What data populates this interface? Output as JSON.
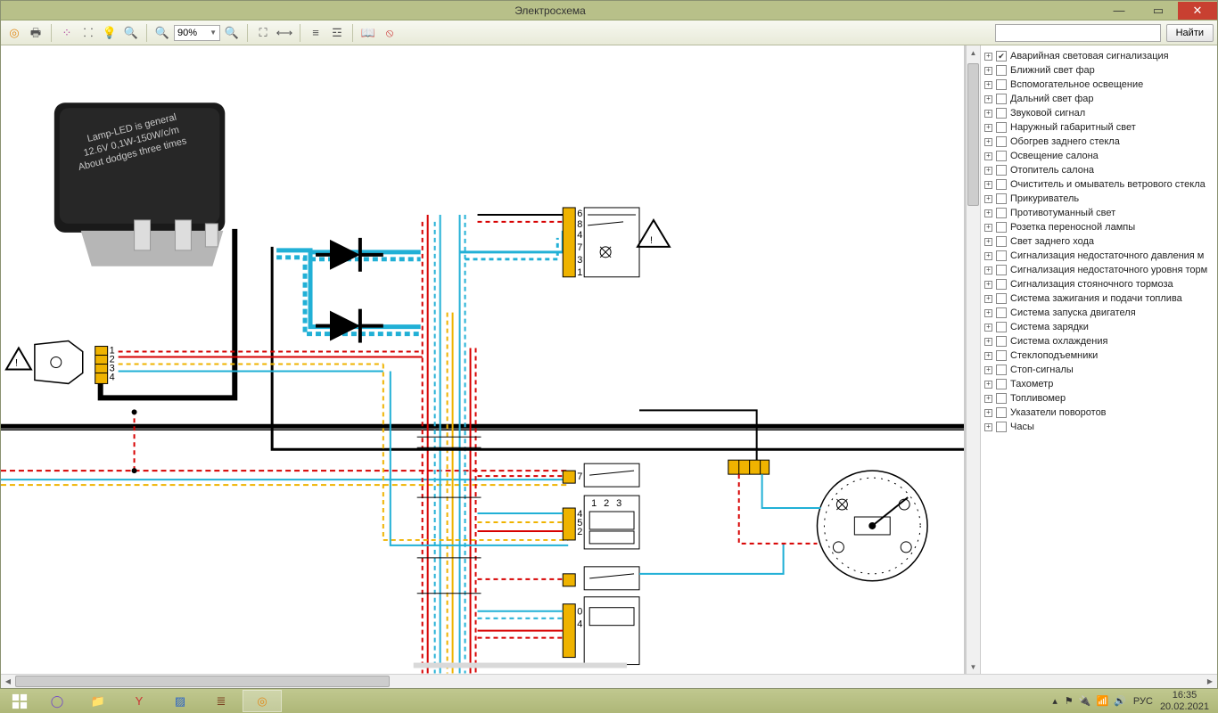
{
  "window": {
    "title": "Электросхема"
  },
  "toolbar": {
    "zoom_value": "90%",
    "find_label": "Найти",
    "search_placeholder": ""
  },
  "sidepanel": {
    "items": [
      {
        "label": "Аварийная световая сигнализация",
        "checked": true
      },
      {
        "label": "Ближний свет фар",
        "checked": false
      },
      {
        "label": "Вспомогательное освещение",
        "checked": false
      },
      {
        "label": "Дальний свет фар",
        "checked": false
      },
      {
        "label": "Звуковой сигнал",
        "checked": false
      },
      {
        "label": "Наружный габаритный свет",
        "checked": false
      },
      {
        "label": "Обогрев заднего стекла",
        "checked": false
      },
      {
        "label": "Освещение салона",
        "checked": false
      },
      {
        "label": "Отопитель салона",
        "checked": false
      },
      {
        "label": "Очиститель и омыватель ветрового стекла",
        "checked": false
      },
      {
        "label": "Прикуриватель",
        "checked": false
      },
      {
        "label": "Противотуманный свет",
        "checked": false
      },
      {
        "label": "Розетка переносной лампы",
        "checked": false
      },
      {
        "label": "Свет заднего хода",
        "checked": false
      },
      {
        "label": "Сигнализация недостаточного давления м",
        "checked": false
      },
      {
        "label": "Сигнализация недостаточного уровня торм",
        "checked": false
      },
      {
        "label": "Сигнализация стояночного тормоза",
        "checked": false
      },
      {
        "label": "Система зажигания и подачи топлива",
        "checked": false
      },
      {
        "label": "Система запуска двигателя",
        "checked": false
      },
      {
        "label": "Система зарядки",
        "checked": false
      },
      {
        "label": "Система охлаждения",
        "checked": false
      },
      {
        "label": "Стеклоподъемники",
        "checked": false
      },
      {
        "label": "Стоп-сигналы",
        "checked": false
      },
      {
        "label": "Тахометр",
        "checked": false
      },
      {
        "label": "Топливомер",
        "checked": false
      },
      {
        "label": "Указатели поворотов",
        "checked": false
      },
      {
        "label": "Часы",
        "checked": false
      }
    ]
  },
  "canvas": {
    "relay_text_lines": [
      "Lamp-LED is general",
      "12.6V 0,1W-150W/c/m",
      "About dodges three times"
    ],
    "connector_left_pins": [
      "1",
      "2",
      "3",
      "4"
    ],
    "connector_top_right_pins": [
      "6",
      "8",
      "4",
      "7",
      "3",
      "1"
    ],
    "connector_mid_pins": [
      "7"
    ],
    "connector_mid2_pins": [
      "4",
      "5",
      "2"
    ],
    "connector_bottom_pins": [
      "0",
      "4"
    ],
    "switch_labels": [
      "1",
      "2",
      "3"
    ]
  },
  "taskbar": {
    "lang": "РУС",
    "time": "16:35",
    "date": "20.02.2021"
  }
}
